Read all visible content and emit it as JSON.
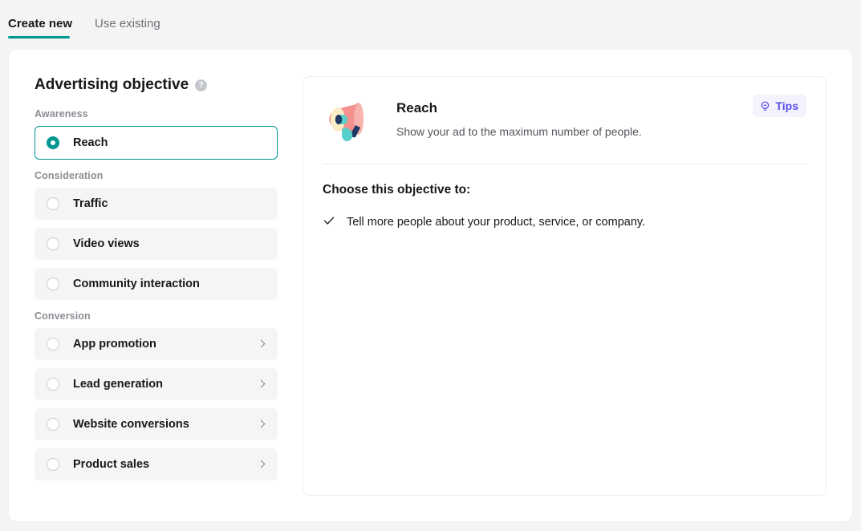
{
  "tabs": [
    {
      "label": "Create new",
      "active": true
    },
    {
      "label": "Use existing",
      "active": false
    }
  ],
  "sidebar": {
    "heading": "Advertising objective",
    "help_icon": "help-circle-icon",
    "groups": [
      {
        "label": "Awareness",
        "options": [
          {
            "label": "Reach",
            "selected": true,
            "has_chevron": false
          }
        ]
      },
      {
        "label": "Consideration",
        "options": [
          {
            "label": "Traffic",
            "selected": false,
            "has_chevron": false
          },
          {
            "label": "Video views",
            "selected": false,
            "has_chevron": false
          },
          {
            "label": "Community interaction",
            "selected": false,
            "has_chevron": false
          }
        ]
      },
      {
        "label": "Conversion",
        "options": [
          {
            "label": "App promotion",
            "selected": false,
            "has_chevron": true
          },
          {
            "label": "Lead generation",
            "selected": false,
            "has_chevron": true
          },
          {
            "label": "Website conversions",
            "selected": false,
            "has_chevron": true
          },
          {
            "label": "Product sales",
            "selected": false,
            "has_chevron": true
          }
        ]
      }
    ]
  },
  "detail": {
    "illustration": "megaphone-illustration",
    "title": "Reach",
    "description": "Show your ad to the maximum number of people.",
    "tips_button": {
      "label": "Tips",
      "icon": "lightbulb-icon"
    },
    "choose_heading": "Choose this objective to:",
    "benefits": [
      "Tell more people about your product, service, or company."
    ]
  },
  "colors": {
    "accent_teal": "#009793",
    "tips_purple": "#5850ec",
    "tips_bg": "#f4f3fd",
    "page_bg": "#f4f4f5",
    "row_bg": "#f5f5f6",
    "art_pink": "#f4918f",
    "art_cream": "#fbeec6",
    "art_teal": "#57cfca",
    "art_navy": "#1f3864"
  }
}
